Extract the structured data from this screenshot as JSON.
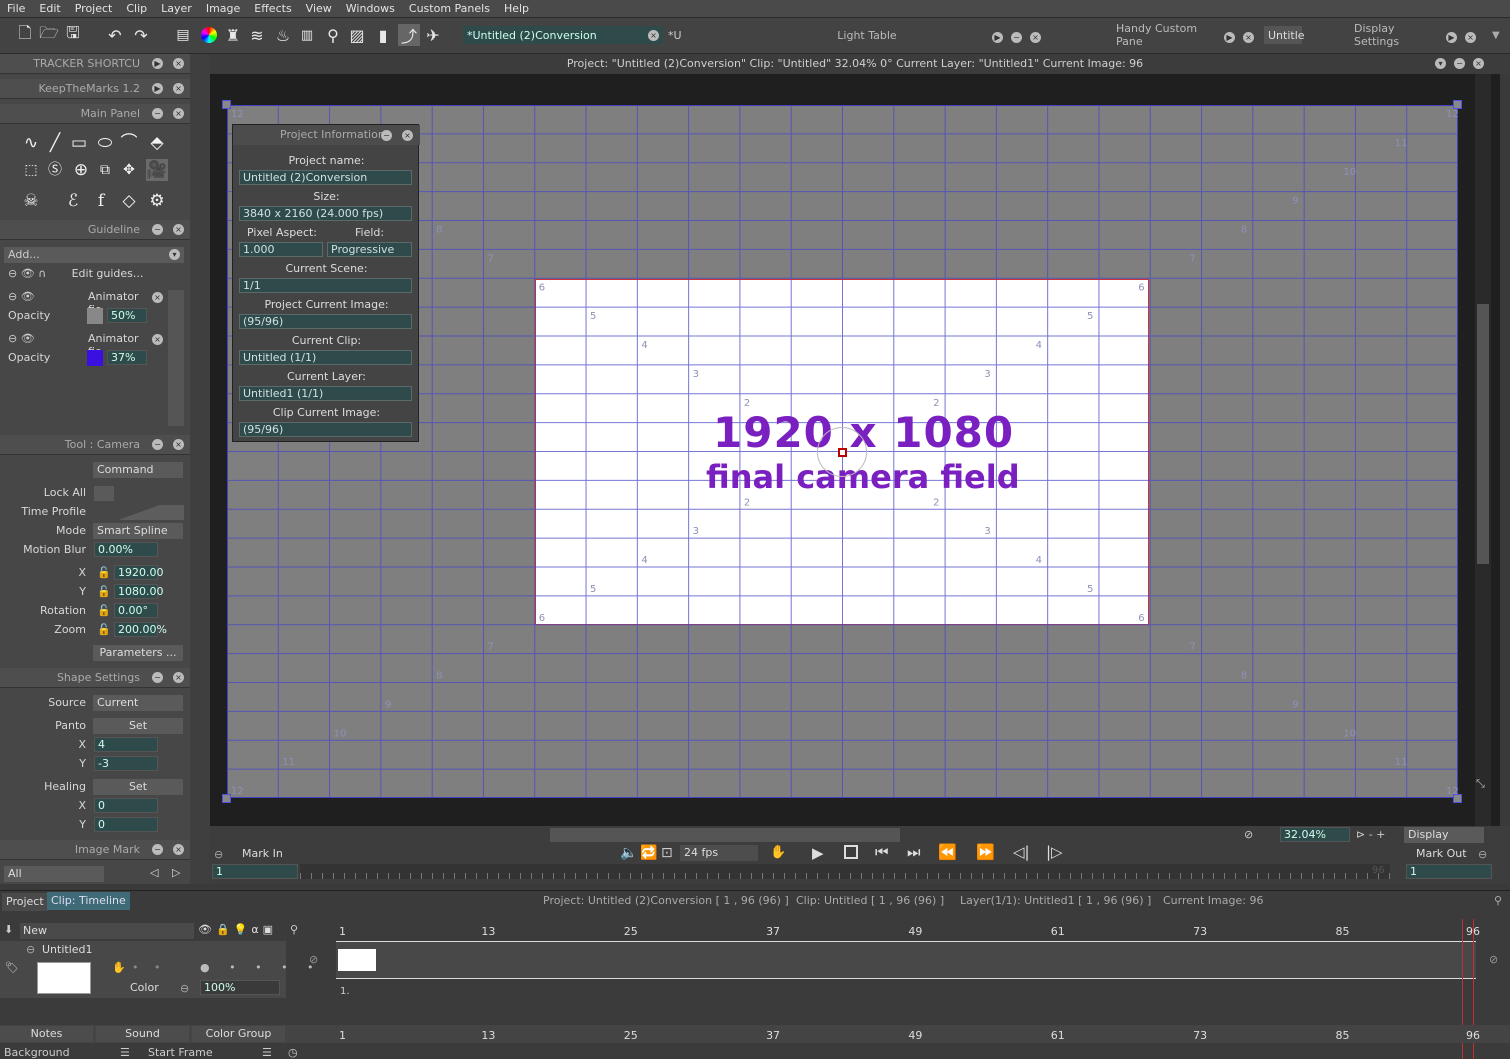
{
  "menu": [
    "File",
    "Edit",
    "Project",
    "Clip",
    "Layer",
    "Image",
    "Effects",
    "View",
    "Windows",
    "Custom Panels",
    "Help"
  ],
  "tabs": {
    "doc_tab": "*Untitled (2)Conversion",
    "doc_tab2": "*U",
    "light_table": "Light Table",
    "handy": "Handy Custom Pane",
    "untitled": "Untitle",
    "display_settings": "Display Settings"
  },
  "left": {
    "tracker": "TRACKER SHORTCU",
    "keepmarks": "KeepTheMarks 1.2",
    "main_panel": "Main Panel",
    "guideline": "Guideline",
    "add": "Add...",
    "edit_guides": "Edit guides...",
    "animator1": "Animator fie",
    "opacity_label": "Opacity",
    "opacity1": "50%",
    "animator2": "Animator fie",
    "opacity2": "37%",
    "tool_camera": "Tool : Camera",
    "command": "Command",
    "lock_all": "Lock All",
    "time_profile": "Time Profile",
    "mode_label": "Mode",
    "mode_value": "Smart Spline",
    "motion_blur_label": "Motion Blur",
    "motion_blur": "0.00%",
    "x_label": "X",
    "x_value": "1920.00",
    "y_label": "Y",
    "y_value": "1080.00",
    "rotation_label": "Rotation",
    "rotation": "0.00°",
    "zoom_label": "Zoom",
    "zoom": "200.00%",
    "parameters": "Parameters ...",
    "shape_settings": "Shape Settings",
    "source_label": "Source",
    "source_value": "Current",
    "panto_label": "Panto",
    "set": "Set",
    "panto_x": "4",
    "panto_y": "-3",
    "healing_label": "Healing",
    "healing_x": "0",
    "healing_y": "0",
    "image_mark": "Image Mark",
    "all": "All"
  },
  "viewport": {
    "status": "Project:  \"Untitled (2)Conversion\"  Clip: \"Untitled\"   32.04%   0°  Current Layer: \"Untitled1\"  Current Image: 96",
    "big1": "1920 x 1080",
    "big2": "final camera field"
  },
  "projinfo": {
    "title": "Project Information",
    "name_label": "Project name:",
    "name": "Untitled (2)Conversion",
    "size_label": "Size:",
    "size": "3840 x 2160 (24.000 fps)",
    "pa_label": "Pixel Aspect:",
    "field_label": "Field:",
    "pa": "1.000",
    "field": "Progressive",
    "scene_label": "Current Scene:",
    "scene": "1/1",
    "pci_label": "Project Current Image:",
    "pci": "(95/96)",
    "clip_label": "Current Clip:",
    "clip": "Untitled (1/1)",
    "layer_label": "Current Layer:",
    "layer": "Untitled1 (1/1)",
    "cci_label": "Clip Current Image:",
    "cci": "(95/96)"
  },
  "playbar": {
    "zoom": "32.04%",
    "display": "Display",
    "mark_in": "Mark In",
    "fps": "24 fps",
    "mark_out": "Mark Out",
    "in_frame": "1",
    "out_frame": "1",
    "end_frame": "96"
  },
  "timeline": {
    "project_tab": "Project",
    "clip_tab": "Clip: Timeline",
    "info_project": "Project: Untitled (2)Conversion [ 1 , 96  (96) ]",
    "info_clip": "Clip: Untitled [ 1 , 96  (96) ]",
    "info_layer": "Layer(1/1): Untitled1 [ 1 , 96  (96) ]",
    "info_image": "Current Image: 96",
    "new": "New",
    "layer_name": "Untitled1",
    "color": "Color",
    "opacity": "100%",
    "ticks": [
      "1",
      "13",
      "25",
      "37",
      "49",
      "61",
      "73",
      "85",
      "96"
    ],
    "frame_label": "1.",
    "notes": "Notes",
    "sound": "Sound",
    "color_group": "Color Group",
    "background": "Background",
    "start_frame": "Start Frame"
  },
  "grid_numbers": {
    "n2": "2",
    "n3": "3",
    "n4": "4",
    "n5": "5",
    "n6": "6",
    "n7": "7",
    "n8": "8",
    "n9": "9",
    "n10": "10",
    "n11": "11",
    "n12": "12"
  },
  "colors": {
    "accent_purple": "#7a1fc0",
    "grid_line": "#4848c8",
    "camera_border": "#cc3333"
  }
}
